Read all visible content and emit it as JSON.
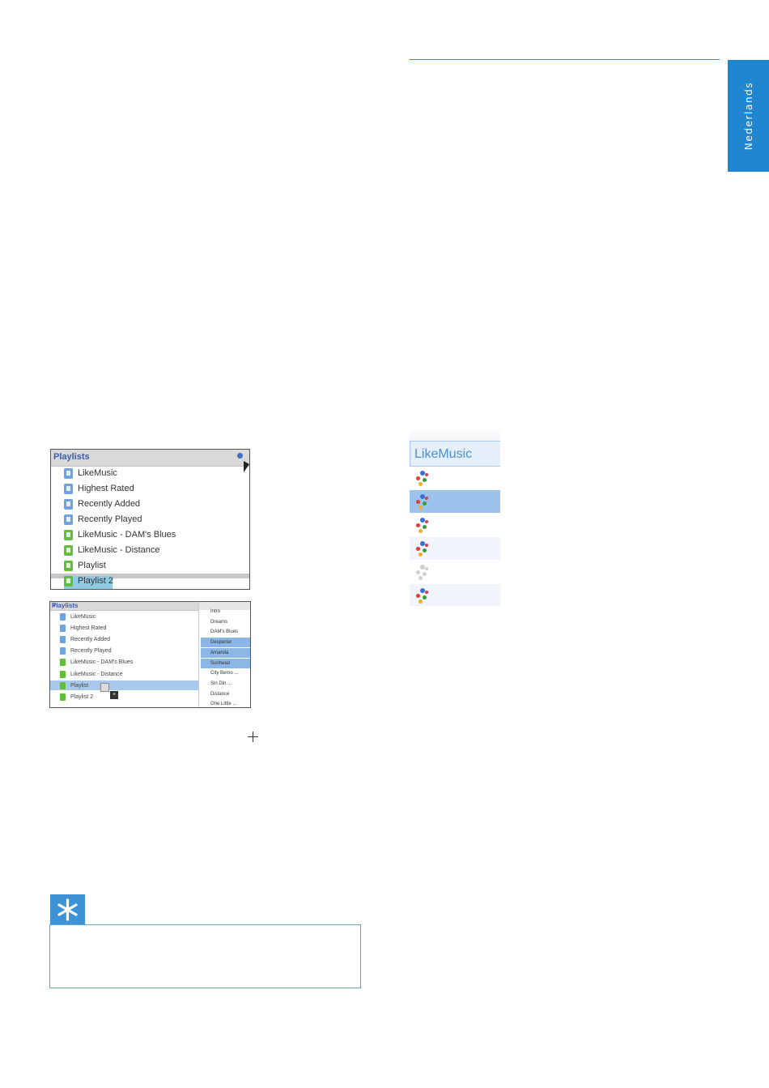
{
  "side_tab": {
    "language": "Nederlands"
  },
  "screenshot_1": {
    "header": "Playlists",
    "items": [
      {
        "label": "LikeMusic",
        "icon": "blue"
      },
      {
        "label": "Highest Rated",
        "icon": "blue"
      },
      {
        "label": "Recently Added",
        "icon": "blue"
      },
      {
        "label": "Recently Played",
        "icon": "blue"
      },
      {
        "label": "LikeMusic - DAM's Blues",
        "icon": "green"
      },
      {
        "label": "LikeMusic - Distance",
        "icon": "green"
      },
      {
        "label": "Playlist",
        "icon": "green"
      },
      {
        "label": "Playlist 2",
        "icon": "green"
      }
    ]
  },
  "screenshot_2": {
    "header": "Playlists",
    "close": "×",
    "items": [
      {
        "label": "LikeMusic",
        "icon": "blue"
      },
      {
        "label": "Highest Rated",
        "icon": "blue"
      },
      {
        "label": "Recently Added",
        "icon": "blue"
      },
      {
        "label": "Recently Played",
        "icon": "blue"
      },
      {
        "label": "LikeMusic - DAM's Blues",
        "icon": "green"
      },
      {
        "label": "LikeMusic - Distance",
        "icon": "green"
      },
      {
        "label": "Playlist",
        "icon": "green"
      },
      {
        "label": "Playlist 2",
        "icon": "green"
      }
    ],
    "drag_badge": "+",
    "songs": [
      {
        "label": "Intro",
        "selected": false
      },
      {
        "label": "Dreams",
        "selected": false
      },
      {
        "label": "DAM's Blues",
        "selected": false
      },
      {
        "label": "Despertar",
        "selected": true
      },
      {
        "label": "Amanda",
        "selected": true
      },
      {
        "label": "Sunhead",
        "selected": true
      },
      {
        "label": "City Bemo ...",
        "selected": false
      },
      {
        "label": "Sin Din ...",
        "selected": false
      },
      {
        "label": "Distance",
        "selected": false
      },
      {
        "label": "One Little ...",
        "selected": false
      }
    ]
  },
  "likemusic": {
    "title": "LikeMusic",
    "rows": [
      "odd",
      "sel",
      "odd",
      "even",
      "odd",
      "even"
    ]
  },
  "colors": {
    "accent": "#1f86cf",
    "tip": "#3d93d6"
  }
}
